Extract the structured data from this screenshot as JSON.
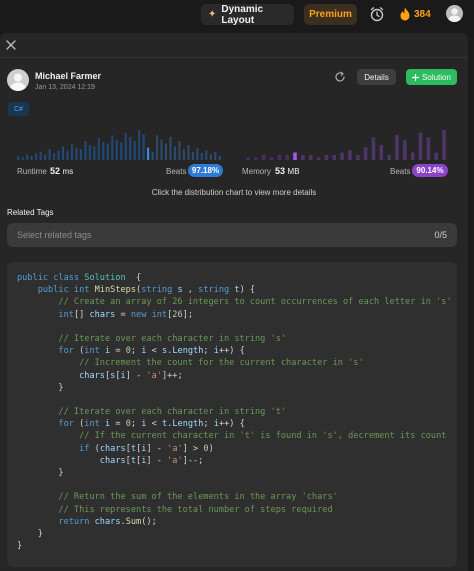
{
  "topbar": {
    "dynamic_layout_label": "Dynamic Layout",
    "premium_label": "Premium",
    "streak_count": "384"
  },
  "colors": {
    "accent_green": "#2cbb5d",
    "premium_orange": "#ffa116",
    "runtime_blue": "#2e7bd6",
    "memory_purple": "#8e44c9",
    "panel_bg": "#262626",
    "code_bg": "#2f2f2f"
  },
  "submission": {
    "author": "Michael Farmer",
    "date": "Jan 13, 2024 12:19",
    "details_label": "Details",
    "solution_label": "Solution",
    "language": "C#"
  },
  "stats": {
    "runtime_label": "Runtime",
    "runtime_value": "52",
    "runtime_unit": "ms",
    "runtime_beats_label": "Beats",
    "runtime_beats": "97.18%",
    "memory_label": "Memory",
    "memory_value": "53",
    "memory_unit": "MB",
    "memory_beats_label": "Beats",
    "memory_beats": "90.14%",
    "hint": "Click the distribution chart to view more details"
  },
  "chart_data": [
    {
      "type": "bar",
      "name": "runtime-distribution",
      "highlight_index": 29,
      "values": [
        3,
        2,
        4,
        3,
        5,
        6,
        4,
        8,
        5,
        7,
        10,
        7,
        12,
        9,
        8,
        14,
        11,
        10,
        16,
        13,
        12,
        18,
        15,
        13,
        20,
        17,
        14,
        22,
        19,
        9,
        6,
        18,
        15,
        12,
        17,
        10,
        14,
        8,
        11,
        6,
        9,
        5,
        7,
        4,
        6,
        3
      ]
    },
    {
      "type": "bar",
      "name": "memory-distribution",
      "highlight_index": 6,
      "values": [
        1,
        1,
        2,
        1,
        2,
        2,
        3,
        2,
        2,
        1,
        2,
        2,
        3,
        4,
        2,
        5,
        9,
        6,
        2,
        10,
        8,
        3,
        11,
        9,
        3,
        12
      ]
    }
  ],
  "tags": {
    "label": "Related Tags",
    "placeholder": "Select related tags",
    "count": "0/5"
  },
  "code_lines": [
    [
      [
        "kw",
        "public "
      ],
      [
        "kw",
        "class "
      ],
      [
        "ty",
        "Solution"
      ],
      [
        "",
        "  {"
      ]
    ],
    [
      [
        "",
        "    "
      ],
      [
        "kw",
        "public "
      ],
      [
        "kw",
        "int "
      ],
      [
        "fn",
        "MinSteps"
      ],
      [
        "",
        "("
      ],
      [
        "kw",
        "string "
      ],
      [
        "id",
        "s"
      ],
      [
        "",
        " , "
      ],
      [
        "kw",
        "string "
      ],
      [
        "id",
        "t"
      ],
      [
        "",
        ") {"
      ]
    ],
    [
      [
        "",
        "        "
      ],
      [
        "cm",
        "// Create an array of 26 integers to count occurrences of each letter in 's'"
      ]
    ],
    [
      [
        "",
        "        "
      ],
      [
        "kw",
        "int"
      ],
      [
        "",
        "[] "
      ],
      [
        "id",
        "chars"
      ],
      [
        "",
        " = "
      ],
      [
        "kw",
        "new "
      ],
      [
        "kw",
        "int"
      ],
      [
        "",
        "["
      ],
      [
        "nm",
        "26"
      ],
      [
        "",
        "];"
      ]
    ],
    [
      [
        "",
        ""
      ]
    ],
    [
      [
        "",
        "        "
      ],
      [
        "cm",
        "// Iterate over each character in string 's'"
      ]
    ],
    [
      [
        "",
        "        "
      ],
      [
        "kw",
        "for "
      ],
      [
        "",
        "("
      ],
      [
        "kw",
        "int "
      ],
      [
        "id",
        "i"
      ],
      [
        "",
        " = "
      ],
      [
        "nm",
        "0"
      ],
      [
        "",
        "; "
      ],
      [
        "id",
        "i"
      ],
      [
        "",
        " < "
      ],
      [
        "id",
        "s"
      ],
      [
        "",
        "."
      ],
      [
        "id",
        "Length"
      ],
      [
        "",
        "; "
      ],
      [
        "id",
        "i"
      ],
      [
        "",
        "++) {"
      ]
    ],
    [
      [
        "",
        "            "
      ],
      [
        "cm",
        "// Increment the count for the current character in 's'"
      ]
    ],
    [
      [
        "",
        "            "
      ],
      [
        "id",
        "chars"
      ],
      [
        "",
        "["
      ],
      [
        "id",
        "s"
      ],
      [
        "",
        "["
      ],
      [
        "id",
        "i"
      ],
      [
        "",
        "] - "
      ],
      [
        "st",
        "'a'"
      ],
      [
        "",
        "]++;"
      ]
    ],
    [
      [
        "",
        "        }"
      ]
    ],
    [
      [
        "",
        ""
      ]
    ],
    [
      [
        "",
        "        "
      ],
      [
        "cm",
        "// Iterate over each character in string 't'"
      ]
    ],
    [
      [
        "",
        "        "
      ],
      [
        "kw",
        "for "
      ],
      [
        "",
        "("
      ],
      [
        "kw",
        "int "
      ],
      [
        "id",
        "i"
      ],
      [
        "",
        " = "
      ],
      [
        "nm",
        "0"
      ],
      [
        "",
        "; "
      ],
      [
        "id",
        "i"
      ],
      [
        "",
        " < "
      ],
      [
        "id",
        "t"
      ],
      [
        "",
        "."
      ],
      [
        "id",
        "Length"
      ],
      [
        "",
        "; "
      ],
      [
        "id",
        "i"
      ],
      [
        "",
        "++) {"
      ]
    ],
    [
      [
        "",
        "            "
      ],
      [
        "cm",
        "// If the current character in 't' is found in 's', decrement its count"
      ]
    ],
    [
      [
        "",
        "            "
      ],
      [
        "kw",
        "if "
      ],
      [
        "",
        "("
      ],
      [
        "id",
        "chars"
      ],
      [
        "",
        "["
      ],
      [
        "id",
        "t"
      ],
      [
        "",
        "["
      ],
      [
        "id",
        "i"
      ],
      [
        "",
        "] - "
      ],
      [
        "st",
        "'a'"
      ],
      [
        "",
        "] > "
      ],
      [
        "nm",
        "0"
      ],
      [
        "",
        ")"
      ]
    ],
    [
      [
        "",
        "                "
      ],
      [
        "id",
        "chars"
      ],
      [
        "",
        "["
      ],
      [
        "id",
        "t"
      ],
      [
        "",
        "["
      ],
      [
        "id",
        "i"
      ],
      [
        "",
        "] - "
      ],
      [
        "st",
        "'a'"
      ],
      [
        "",
        "]--;"
      ]
    ],
    [
      [
        "",
        "        }"
      ]
    ],
    [
      [
        "",
        ""
      ]
    ],
    [
      [
        "",
        "        "
      ],
      [
        "cm",
        "// Return the sum of the elements in the array 'chars'"
      ]
    ],
    [
      [
        "",
        "        "
      ],
      [
        "cm",
        "// This represents the total number of steps required"
      ]
    ],
    [
      [
        "",
        "        "
      ],
      [
        "kw",
        "return "
      ],
      [
        "id",
        "chars"
      ],
      [
        "",
        "."
      ],
      [
        "fn",
        "Sum"
      ],
      [
        "",
        "();"
      ]
    ],
    [
      [
        "",
        "    }"
      ]
    ],
    [
      [
        "",
        "}"
      ]
    ]
  ]
}
